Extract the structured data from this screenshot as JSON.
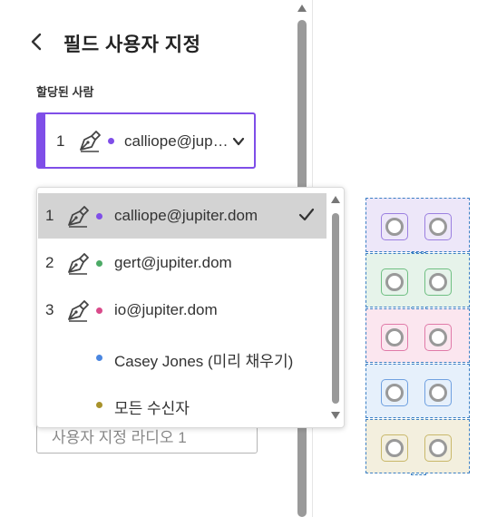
{
  "panel": {
    "title": "필드 사용자 지정",
    "assignee_label": "할당된 사람"
  },
  "select": {
    "number": "1",
    "email": "calliope@jup…",
    "dot_color": "#7f4ee8",
    "border_color": "#7f4ee8"
  },
  "dropdown": {
    "options": [
      {
        "number": "1",
        "label": "calliope@jupiter.dom",
        "dot_color": "#7f4ee8",
        "selected": true
      },
      {
        "number": "2",
        "label": "gert@jupiter.dom",
        "dot_color": "#4caa66"
      },
      {
        "number": "3",
        "label": "io@jupiter.dom",
        "dot_color": "#d94a8a"
      },
      {
        "label": "Casey Jones (미리 채우기)",
        "dot_color": "#4a86e0"
      },
      {
        "label": "모든 수신자",
        "dot_color": "#a8922b"
      }
    ]
  },
  "radio_field": {
    "value": "사용자 지정 라디오 1"
  },
  "canvas": {
    "groups": [
      {
        "fill": "#ede7f9",
        "box": "#9b7fe0"
      },
      {
        "fill": "#e6f3ea",
        "box": "#6fbf82"
      },
      {
        "fill": "#fbe6ef",
        "box": "#e07aa8"
      },
      {
        "fill": "#e6f0fb",
        "box": "#6fa0e0"
      },
      {
        "fill": "#f3efde",
        "box": "#c9b86a"
      }
    ]
  }
}
